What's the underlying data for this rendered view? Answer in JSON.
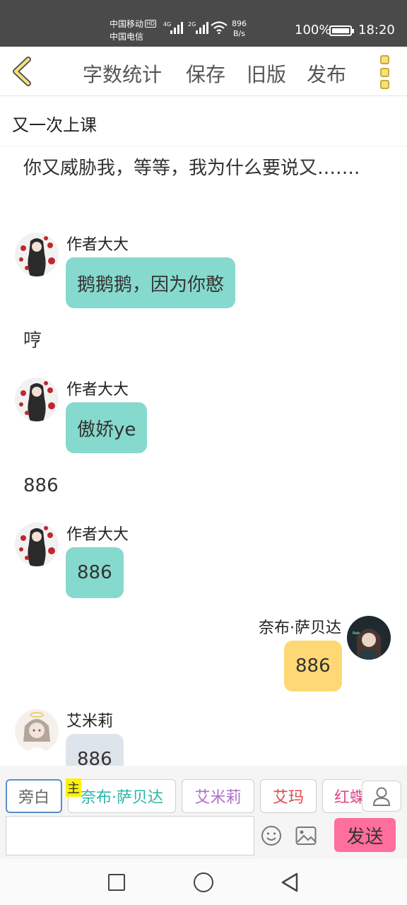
{
  "status_bar": {
    "carrier1": "中国移动",
    "carrier1_badge": "HD",
    "carrier2": "中国电信",
    "net1": "4G",
    "net2": "2G",
    "speed_value": "896",
    "speed_unit": "B/s",
    "battery": "100%",
    "battery_level": 1.0,
    "time": "18:20"
  },
  "toolbar": {
    "back_icon": "chevron-left-icon",
    "word_count": "字数统计",
    "save": "保存",
    "old_version": "旧版",
    "publish": "发布",
    "more_icon": "more-vertical-icon",
    "accent_color": "#f6e27a"
  },
  "chapter_title": "又一次上课",
  "messages": [
    {
      "type": "narration",
      "text": "你又威胁我，等等，我为什么要说又……."
    },
    {
      "type": "left",
      "sender": "作者大大",
      "text": "鹅鹅鹅，因为你憨",
      "color": "#86d9cd"
    },
    {
      "type": "narration",
      "text": "哼"
    },
    {
      "type": "left",
      "sender": "作者大大",
      "text": "傲娇ye",
      "color": "#86d9cd"
    },
    {
      "type": "narration",
      "text": "886"
    },
    {
      "type": "left",
      "sender": "作者大大",
      "text": "886",
      "color": "#86d9cd"
    },
    {
      "type": "right",
      "sender": "奈布·萨贝达",
      "text": "886",
      "color": "#fdd874"
    },
    {
      "type": "left",
      "sender": "艾米莉",
      "text": "886",
      "color": "#dde4ec"
    }
  ],
  "roles": [
    {
      "label": "旁白",
      "color": "#666666",
      "active": true
    },
    {
      "label": "奈布·萨贝达",
      "color": "#2bb5a8",
      "owner_badge": "主"
    },
    {
      "label": "艾米莉",
      "color": "#b06fc8"
    },
    {
      "label": "艾玛",
      "color": "#e0474b"
    },
    {
      "label": "红蝶",
      "color": "#e0478a"
    }
  ],
  "input": {
    "placeholder": ""
  },
  "send_label": "发送",
  "nav": {
    "recent_icon": "square-icon",
    "home_icon": "circle-icon",
    "back_icon": "triangle-back-icon"
  }
}
